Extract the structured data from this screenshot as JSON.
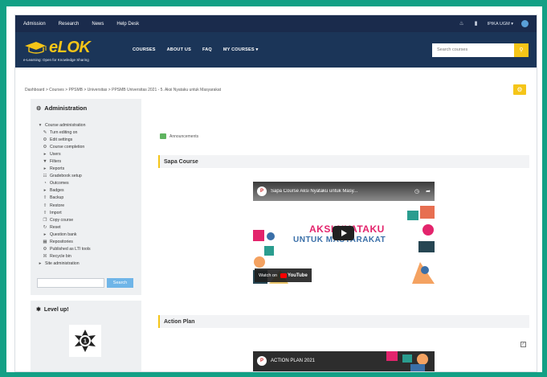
{
  "topbar": {
    "links": [
      "Admission",
      "Research",
      "News",
      "Help Desk"
    ],
    "user": "IPIKA UGM"
  },
  "navbar": {
    "logo": "eLOK",
    "tagline": "e-Learning: Open for Knowledge Sharing",
    "menu": [
      "COURSES",
      "ABOUT US",
      "FAQ",
      "MY COURSES ▾"
    ],
    "search_placeholder": "Search courses"
  },
  "breadcrumb": "Dashboard  >  Courses  >  PPSMB  >  Universitas  >  PPSMB Universitas 2021 - 5. Aksi Nyataku untuk Masyarakat",
  "admin": {
    "title": "Administration",
    "items": [
      {
        "label": "Course administration",
        "icon": "▾",
        "sub": false
      },
      {
        "label": "Turn editing on",
        "icon": "✎",
        "sub": true
      },
      {
        "label": "Edit settings",
        "icon": "⚙",
        "sub": true
      },
      {
        "label": "Course completion",
        "icon": "⚙",
        "sub": true
      },
      {
        "label": "Users",
        "icon": "▸",
        "sub": true
      },
      {
        "label": "Filters",
        "icon": "▼",
        "sub": true
      },
      {
        "label": "Reports",
        "icon": "▸",
        "sub": true
      },
      {
        "label": "Gradebook setup",
        "icon": "☷",
        "sub": true
      },
      {
        "label": "Outcomes",
        "icon": "◔",
        "sub": true
      },
      {
        "label": "Badges",
        "icon": "▸",
        "sub": true
      },
      {
        "label": "Backup",
        "icon": "⇧",
        "sub": true
      },
      {
        "label": "Restore",
        "icon": "⇧",
        "sub": true
      },
      {
        "label": "Import",
        "icon": "⇧",
        "sub": true
      },
      {
        "label": "Copy course",
        "icon": "❐",
        "sub": true
      },
      {
        "label": "Reset",
        "icon": "↻",
        "sub": true
      },
      {
        "label": "Question bank",
        "icon": "▸",
        "sub": true
      },
      {
        "label": "Repositories",
        "icon": "▦",
        "sub": true
      },
      {
        "label": "Published as LTI tools",
        "icon": "⚙",
        "sub": true
      },
      {
        "label": "Recycle bin",
        "icon": "☒",
        "sub": true
      },
      {
        "label": "Site administration",
        "icon": "▸",
        "sub": false
      }
    ],
    "search_button": "Search"
  },
  "level": {
    "title": "Level up!"
  },
  "content": {
    "announcements": "Announcements",
    "section1": "Sapa Course",
    "video1": {
      "title": "Sapa Course Aksi Nyataku untuk Masy...",
      "line1": "AKSI NYATAKU",
      "line2": "UNTUK MASYARAKAT",
      "watch_on": "Watch on",
      "yt": "YouTube"
    },
    "section2": "Action Plan",
    "video2": {
      "title": "ACTION PLAN 2021"
    }
  }
}
